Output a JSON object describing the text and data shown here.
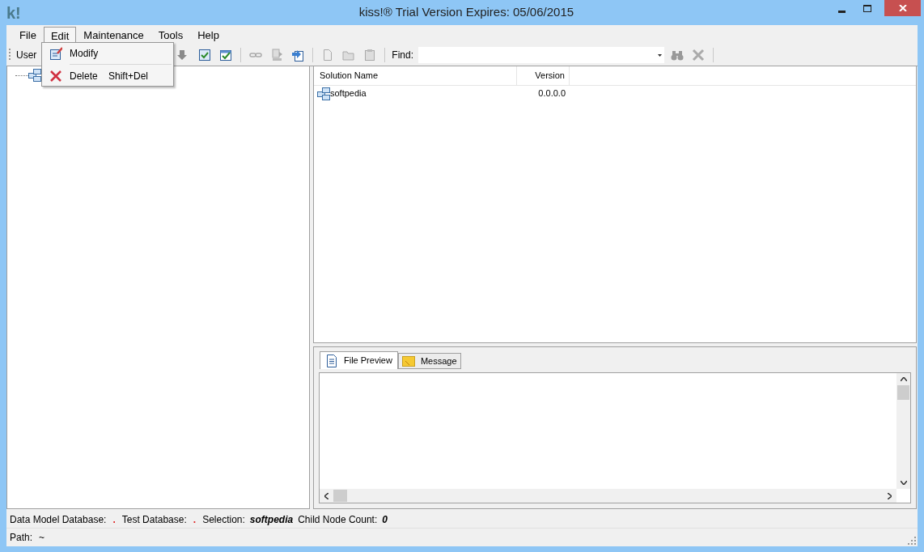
{
  "window": {
    "title": "kiss!® Trial Version Expires: 05/06/2015",
    "logo": "k!"
  },
  "menu_bar": [
    {
      "label": "File",
      "selected": false
    },
    {
      "label": "Edit",
      "selected": true
    },
    {
      "label": "Maintenance",
      "selected": false
    },
    {
      "label": "Tools",
      "selected": false
    },
    {
      "label": "Help",
      "selected": false
    }
  ],
  "edit_menu": [
    {
      "label": "Modify",
      "kind": "modify"
    },
    {
      "label": "Delete",
      "shortcut": "Shift+Del",
      "kind": "delete"
    }
  ],
  "toolbar": {
    "label": "User",
    "find_label": "Find:"
  },
  "solutions_table": {
    "columns": [
      "Solution Name",
      "Version"
    ],
    "rows": [
      {
        "name": "softpedia",
        "version": "0.0.0.0"
      }
    ]
  },
  "bottom_tabs": [
    {
      "label": "File Preview",
      "kind": "file",
      "selected": true
    },
    {
      "label": "Message",
      "kind": "message",
      "selected": false
    }
  ],
  "status_bar": {
    "fields": [
      {
        "label": "Data Model Database:",
        "value": ".",
        "kind": "dot"
      },
      {
        "label": "Test Database:",
        "value": ".",
        "kind": "dot"
      },
      {
        "label": "Selection:",
        "value": "softpedia",
        "kind": "bold"
      },
      {
        "label": "Child Node Count:",
        "value": "0",
        "kind": "bold"
      }
    ],
    "path_label": "Path:",
    "path": "~"
  }
}
